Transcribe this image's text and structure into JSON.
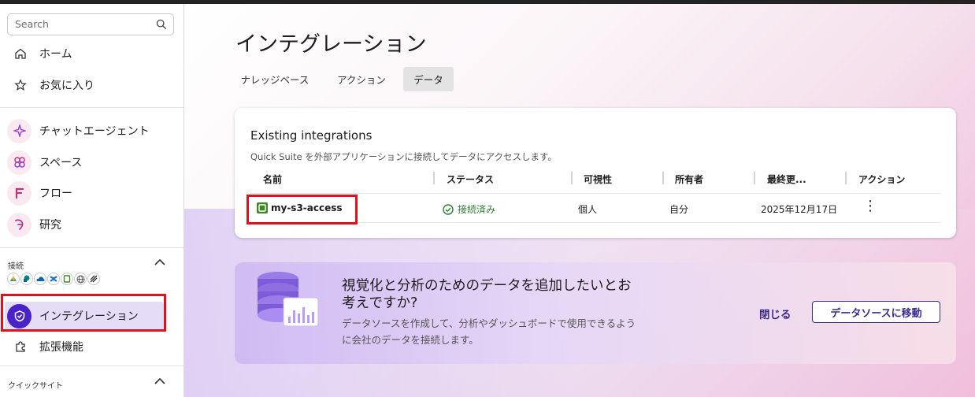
{
  "sidebar": {
    "search_placeholder": "Search",
    "nav": [
      {
        "label": "ホーム"
      },
      {
        "label": "お気に入り"
      },
      {
        "label": "チャットエージェント"
      },
      {
        "label": "スペース"
      },
      {
        "label": "フロー"
      },
      {
        "label": "研究"
      }
    ],
    "connections_label": "接続",
    "connection_icons": [
      "google-drive-icon",
      "sharepoint-icon",
      "onedrive-icon",
      "confluence-icon",
      "s3-icon",
      "web-icon",
      "other-icon"
    ],
    "integrations_label": "インテグレーション",
    "extensions_label": "拡張機能",
    "quicksight_label": "クイックサイト"
  },
  "main": {
    "title": "インテグレーション",
    "tabs": [
      {
        "label": "ナレッジベース"
      },
      {
        "label": "アクション"
      },
      {
        "label": "データ",
        "active": true
      }
    ],
    "card": {
      "title": "Existing integrations",
      "subtitle": "Quick Suite を外部アプリケーションに接続してデータにアクセスします。",
      "columns": [
        "名前",
        "ステータス",
        "可視性",
        "所有者",
        "最終更...",
        "アクション"
      ],
      "rows": [
        {
          "name": "my-s3-access",
          "status": "接続済み",
          "visibility": "個人",
          "owner": "自分",
          "updated": "2025年12月17日"
        }
      ]
    },
    "banner": {
      "headline": "視覚化と分析のためのデータを追加したいとお考えですか?",
      "body": "データソースを作成して、分析やダッシュボードで使用できるように会社のデータを接続します。",
      "close_label": "閉じる",
      "goto_label": "データソースに移動"
    }
  },
  "colors": {
    "accent": "#3b2b8f",
    "status_green": "#2e7d32",
    "highlight_red": "#e2101a"
  }
}
